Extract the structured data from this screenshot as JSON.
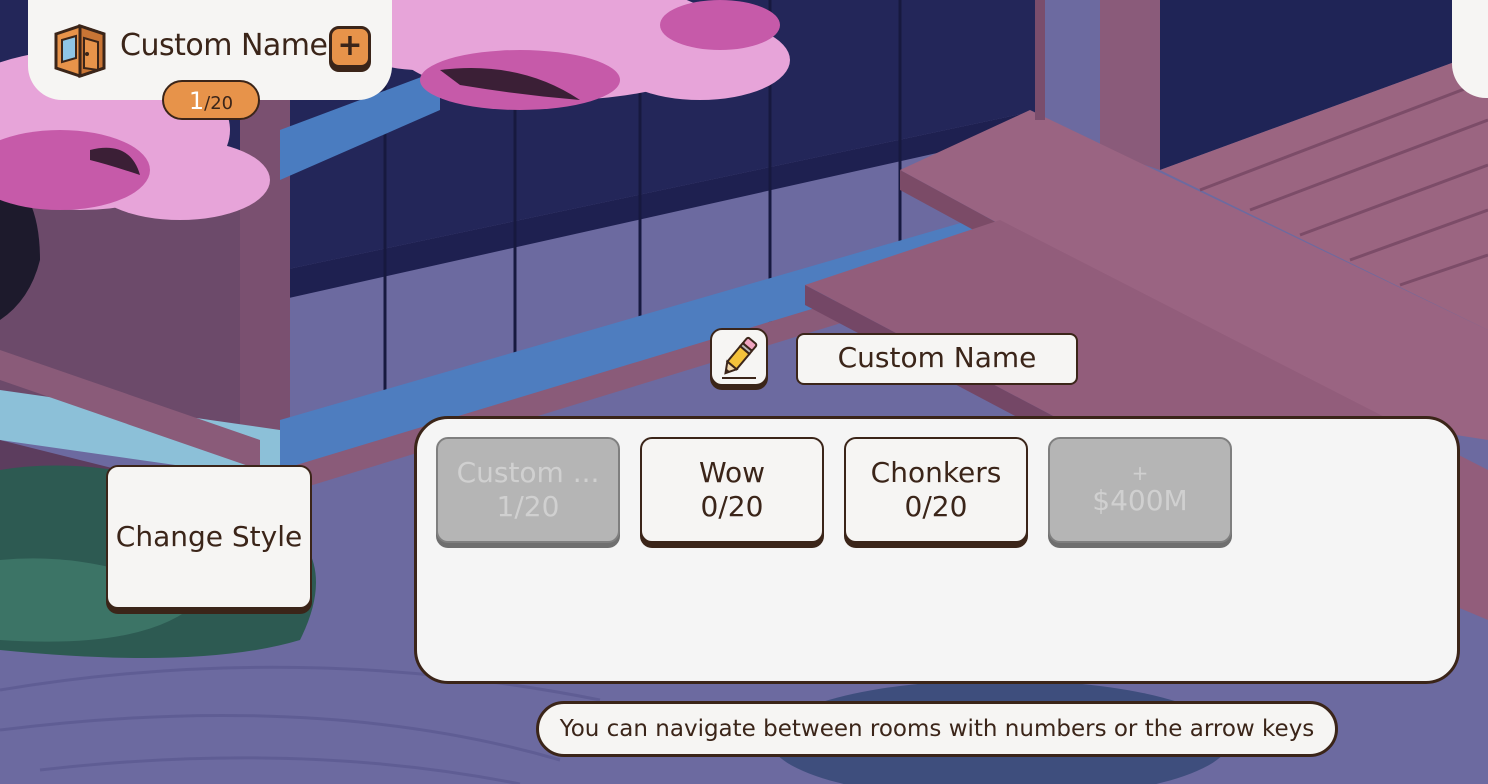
{
  "room": {
    "name": "Custom Name",
    "add_label": "+",
    "count_current": "1",
    "count_total": "/20",
    "icon": "room-door-icon"
  },
  "name_editor": {
    "icon": "pencil-icon",
    "value": "Custom Name"
  },
  "change_style_label": "Change Style",
  "styles": [
    {
      "name": "Custom ...",
      "count": "1/20",
      "state": "disabled"
    },
    {
      "name": "Wow",
      "count": "0/20",
      "state": "enabled"
    },
    {
      "name": "Chonkers",
      "count": "0/20",
      "state": "enabled"
    },
    {
      "name": "+",
      "count": "$400M",
      "state": "disabled"
    }
  ],
  "hint": "You can navigate between rooms with numbers or the arrow keys",
  "colors": {
    "ink": "#3b2519",
    "panel": "#f5f5f5",
    "accent_orange": "#e7934a",
    "disabled_gray": "#b5b5b5"
  }
}
